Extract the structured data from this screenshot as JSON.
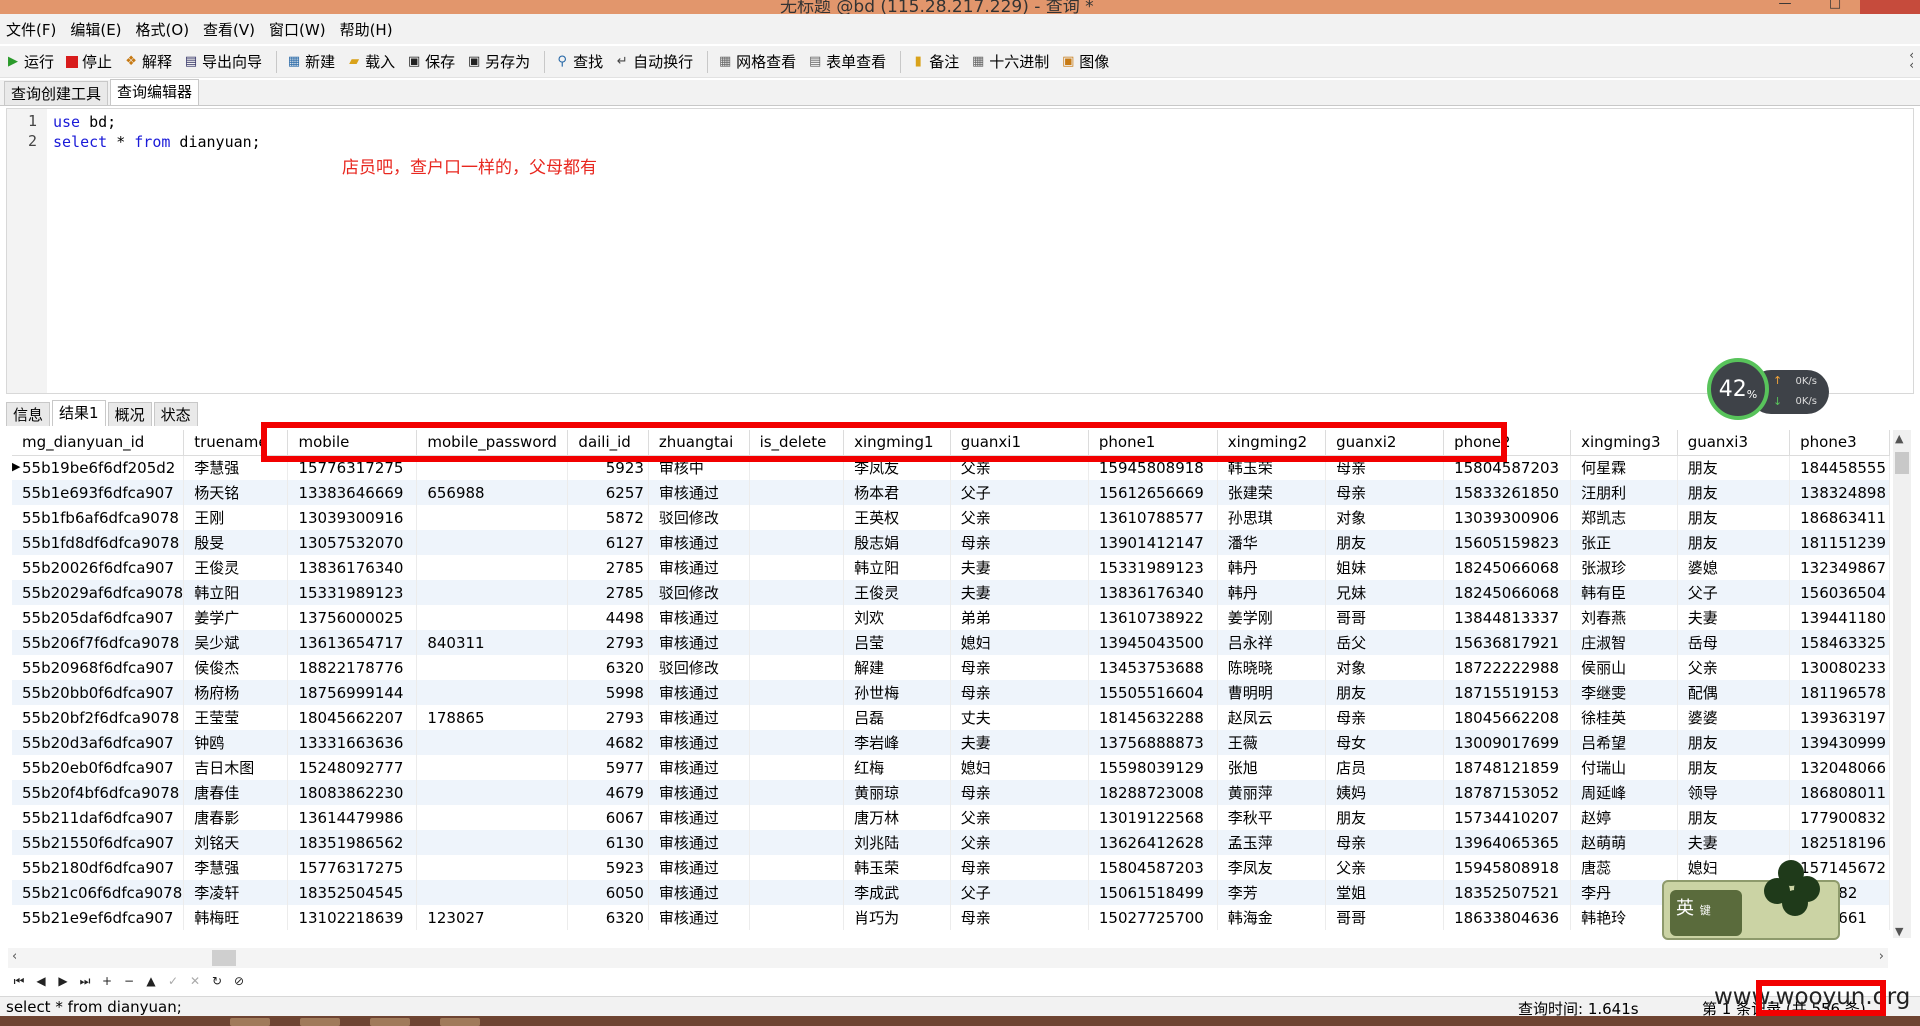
{
  "window": {
    "title": "无标题 @bd (115.28.217.229) - 查询 *"
  },
  "menu": [
    "文件(F)",
    "编辑(E)",
    "格式(O)",
    "查看(V)",
    "窗口(W)",
    "帮助(H)"
  ],
  "toolbar": {
    "run": "运行",
    "stop": "停止",
    "explain": "解释",
    "export": "导出向导",
    "new": "新建",
    "load": "载入",
    "save": "保存",
    "saveas": "另存为",
    "find": "查找",
    "wrap": "自动换行",
    "grid_view": "网格查看",
    "form_view": "表单查看",
    "note": "备注",
    "hex": "十六进制",
    "image": "图像"
  },
  "top_tabs": [
    "查询创建工具",
    "查询编辑器"
  ],
  "editor": {
    "line_numbers": [
      "1",
      "2"
    ],
    "line1_kw": "use",
    "line1_rest": " bd;",
    "line2_kw": "select",
    "line2_mid": " * ",
    "line2_kw2": "from",
    "line2_rest": " dianyuan;",
    "annotation": "店员吧，查户口一样的，父母都有"
  },
  "speed_widget": {
    "percent": "42",
    "unit": "%",
    "up": "0K/s",
    "down": "0K/s"
  },
  "bottom_tabs": [
    "信息",
    "结果1",
    "概况",
    "状态"
  ],
  "grid": {
    "columns": [
      "mg_dianyuan_id",
      "truename",
      "mobile",
      "mobile_password",
      "daili_id",
      "zhuangtai",
      "is_delete",
      "xingming1",
      "guanxi1",
      "phone1",
      "xingming2",
      "guanxi2",
      "phone2",
      "xingming3",
      "guanxi3",
      "phone3"
    ],
    "rows": [
      [
        "55b19be6f6df205d2",
        "李慧强",
        "15776317275",
        "",
        "5923",
        "审核中",
        "",
        "李凤友",
        "父亲",
        "15945808918",
        "韩玉荣",
        "母亲",
        "15804587203",
        "何星霖",
        "朋友",
        "184458555"
      ],
      [
        "55b1e693f6dfca907",
        "杨天铭",
        "13383646669",
        "656988",
        "6257",
        "审核通过",
        "",
        "杨本君",
        "父子",
        "15612656669",
        "张建荣",
        "母亲",
        "15833261850",
        "汪朋利",
        "朋友",
        "138324898"
      ],
      [
        "55b1fb6af6dfca9078",
        "王刚",
        "13039300916",
        "",
        "5872",
        "驳回修改",
        "",
        "王英权",
        "父亲",
        "13610788577",
        "孙思琪",
        "对象",
        "13039300906",
        "郑凯志",
        "朋友",
        "186863411"
      ],
      [
        "55b1fd8df6dfca9078",
        "殷旻",
        "13057532070",
        "",
        "6127",
        "审核通过",
        "",
        "殷志娟",
        "母亲",
        "13901412147",
        "潘华",
        "朋友",
        "15605159823",
        "张正",
        "朋友",
        "181151239"
      ],
      [
        "55b20026f6dfca907",
        "王俊灵",
        "13836176340",
        "",
        "2785",
        "审核通过",
        "",
        "韩立阳",
        "夫妻",
        "15331989123",
        "韩丹",
        "姐妹",
        "18245066068",
        "张淑珍",
        "婆媳",
        "132349867"
      ],
      [
        "55b2029af6dfca9078",
        "韩立阳",
        "15331989123",
        "",
        "2785",
        "驳回修改",
        "",
        "王俊灵",
        "夫妻",
        "13836176340",
        "韩丹",
        "兄妹",
        "18245066068",
        "韩有臣",
        "父子",
        "156036504"
      ],
      [
        "55b205daf6dfca907",
        "姜学广",
        "13756000025",
        "",
        "4498",
        "审核通过",
        "",
        "刘欢",
        "弟弟",
        "13610738922",
        "姜学刚",
        "哥哥",
        "13844813337",
        "刘春燕",
        "夫妻",
        "139441180"
      ],
      [
        "55b206f7f6dfca9078",
        "吴少斌",
        "13613654717",
        "840311",
        "2793",
        "审核通过",
        "",
        "吕莹",
        "媳妇",
        "13945043500",
        "吕永祥",
        "岳父",
        "15636817921",
        "庄淑智",
        "岳母",
        "158463325"
      ],
      [
        "55b20968f6dfca907",
        "侯俊杰",
        "18822178776",
        "",
        "6320",
        "驳回修改",
        "",
        "解建",
        "母亲",
        "13453753688",
        "陈晓晓",
        "对象",
        "18722222988",
        "侯丽山",
        "父亲",
        "130080233"
      ],
      [
        "55b20bb0f6dfca907",
        "杨府杨",
        "18756999144",
        "",
        "5998",
        "审核通过",
        "",
        "孙世梅",
        "母亲",
        "15505516604",
        "曹明明",
        "朋友",
        "18715519153",
        "李继雯",
        "配偶",
        "181196578"
      ],
      [
        "55b20bf2f6dfca9078",
        "王莹莹",
        "18045662207",
        "178865",
        "2793",
        "审核通过",
        "",
        "吕磊",
        "丈夫",
        "18145632288",
        "赵凤云",
        "母亲",
        "18045662208",
        "徐桂英",
        "婆婆",
        "139363197"
      ],
      [
        "55b20d3af6dfca907",
        "钟鸥",
        "13331663636",
        "",
        "4682",
        "审核通过",
        "",
        "李岩峰",
        "夫妻",
        "13756888873",
        "王薇",
        "母女",
        "13009017699",
        "吕希望",
        "朋友",
        "139430999"
      ],
      [
        "55b20eb0f6dfca907",
        "吉日木图",
        "15248092777",
        "",
        "5977",
        "审核通过",
        "",
        "红梅",
        "媳妇",
        "15598039129",
        "张旭",
        "店员",
        "18748121859",
        "付瑞山",
        "朋友",
        "132048066"
      ],
      [
        "55b20f4bf6dfca9078",
        "唐春佳",
        "18083862230",
        "",
        "4679",
        "审核通过",
        "",
        "黄丽琼",
        "母亲",
        "18288723008",
        "黄丽萍",
        "姨妈",
        "18787153052",
        "周延峰",
        "领导",
        "186808011"
      ],
      [
        "55b211daf6dfca907",
        "唐春影",
        "13614479986",
        "",
        "6067",
        "审核通过",
        "",
        "唐万林",
        "父亲",
        "13019122568",
        "李秋平",
        "朋友",
        "15734410207",
        "赵婷",
        "朋友",
        "177900832"
      ],
      [
        "55b21550f6dfca907",
        "刘铭天",
        "18351986562",
        "",
        "6130",
        "审核通过",
        "",
        "刘兆陆",
        "父亲",
        "13626412628",
        "孟玉萍",
        "母亲",
        "13964065365",
        "赵萌萌",
        "夫妻",
        "182518196"
      ],
      [
        "55b2180df6dfca907",
        "李慧强",
        "15776317275",
        "",
        "5923",
        "审核通过",
        "",
        "韩玉荣",
        "母亲",
        "15804587203",
        "李凤友",
        "父亲",
        "15945808918",
        "唐蕊",
        "媳妇",
        "157145672"
      ],
      [
        "55b21c06f6dfca9078",
        "李凌轩",
        "18352504545",
        "",
        "6050",
        "审核通过",
        "",
        "李成武",
        "父子",
        "15061518499",
        "李芳",
        "堂姐",
        "18352507521",
        "李丹",
        "",
        "153482"
      ],
      [
        "55b21e9ef6dfca907",
        "韩梅旺",
        "13102218639",
        "123027",
        "6320",
        "审核通过",
        "",
        "肖巧为",
        "母亲",
        "15027725700",
        "韩海金",
        "哥哥",
        "18633804636",
        "韩艳玲",
        "",
        "1198661"
      ]
    ]
  },
  "ime": {
    "label": "英",
    "sub": "键"
  },
  "status": {
    "sql": "select * from dianyuan;",
    "query_time": "查询时间: 1.641s",
    "record": "第 1 条记录 (共 556 条)"
  },
  "watermark": "www.wooyun.org",
  "colors": {
    "highlight": "#f20000",
    "annotation": "#e8271f",
    "titlebar": "#e2966c"
  }
}
